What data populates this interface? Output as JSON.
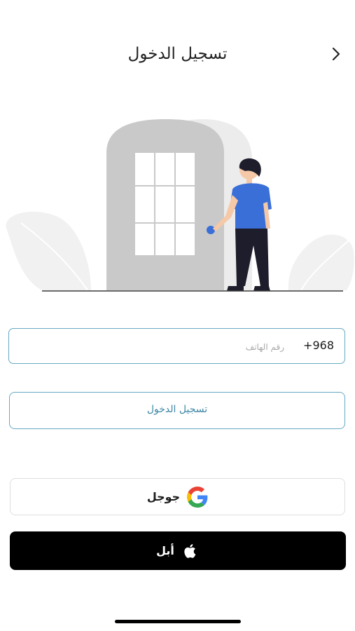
{
  "header": {
    "title": "تسجيل الدخول",
    "back_icon": "chevron-right-icon"
  },
  "illustration": {
    "description_icon": "door-person-illustration"
  },
  "phone": {
    "country_code": "+968",
    "placeholder": "رقم الهاتف",
    "value": ""
  },
  "login_button": {
    "label": "تسجيل الدخول"
  },
  "social": {
    "google_label": "جوجل",
    "google_icon": "google-icon",
    "apple_label": "أبل",
    "apple_icon": "apple-icon"
  },
  "colors": {
    "accent": "#67a9c4",
    "accent_text": "#3e87a6",
    "person_shirt": "#3a6fd8",
    "door": "#c8c8c8"
  }
}
